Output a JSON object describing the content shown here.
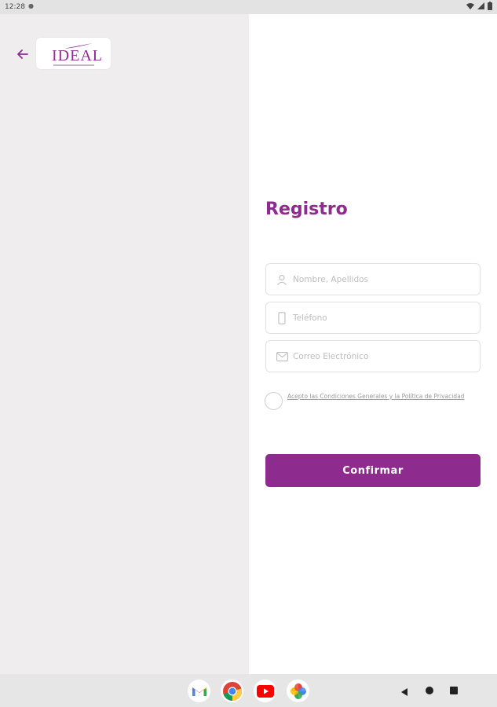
{
  "status_bar": {
    "time": "12:28"
  },
  "header": {
    "logo_text": "IDEAL"
  },
  "form": {
    "title": "Registro",
    "name_placeholder": "Nombre, Apellidos",
    "phone_placeholder": "Teléfono",
    "email_placeholder": "Correo Electrónico",
    "terms_text": "Acepto las Condiciones Generales y la Política de Privacidad",
    "confirm_label": "Confirmar"
  },
  "colors": {
    "accent": "#8d2b8e",
    "left_panel_bg": "#efeded",
    "nav_bg": "#e6e6e6"
  },
  "dock_apps": [
    "gmail-icon",
    "chrome-icon",
    "youtube-icon",
    "photos-icon"
  ]
}
